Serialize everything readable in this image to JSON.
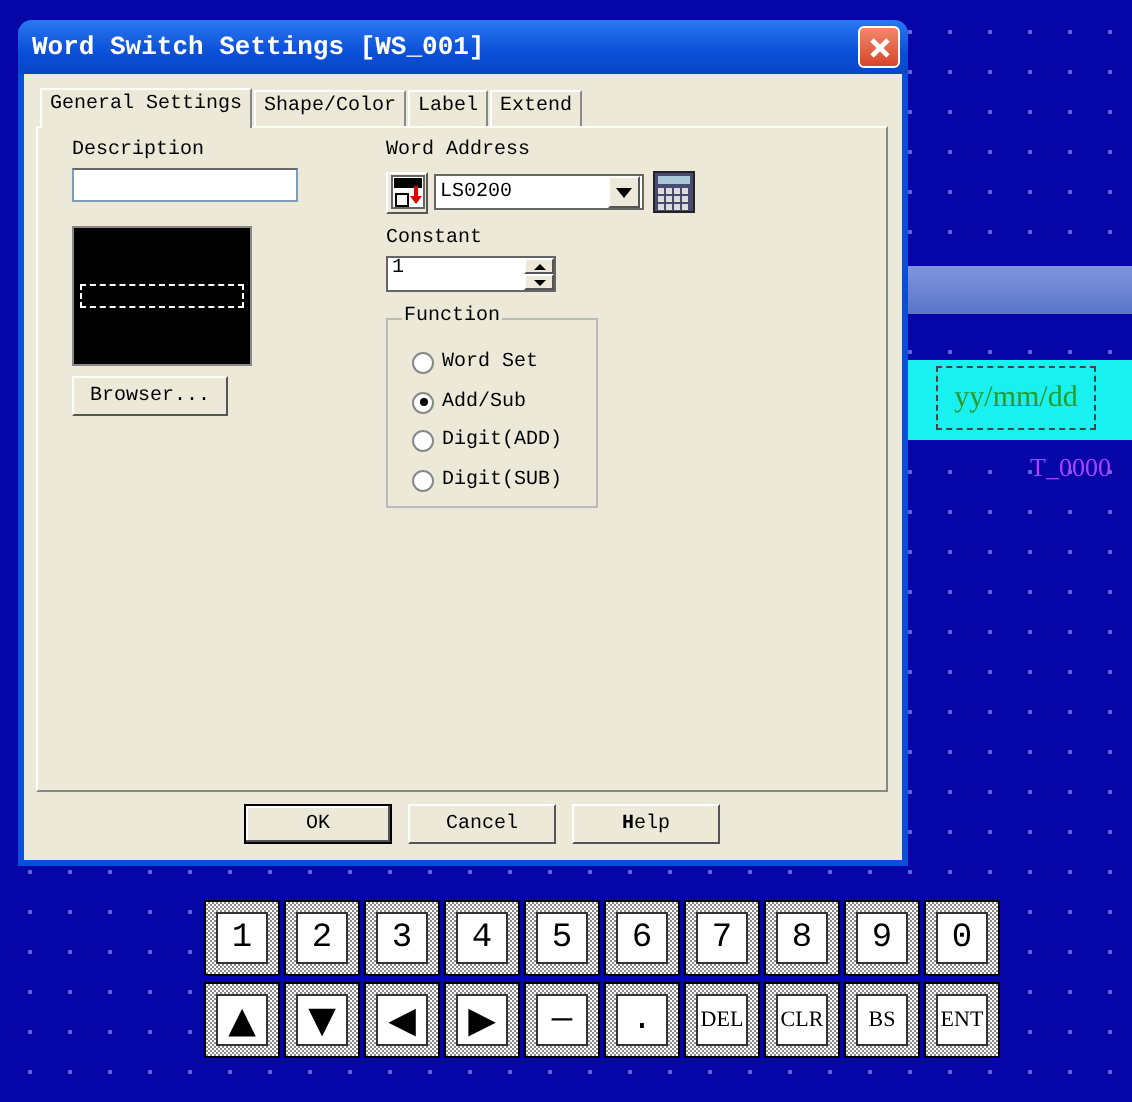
{
  "background": {
    "date_field": "yy/mm/dd",
    "tag": "T_0000"
  },
  "window": {
    "title": "Word Switch Settings [WS_001]"
  },
  "tabs": [
    {
      "label": "General Settings",
      "selected": true
    },
    {
      "label": "Shape/Color",
      "selected": false
    },
    {
      "label": "Label",
      "selected": false
    },
    {
      "label": "Extend",
      "selected": false
    }
  ],
  "description": {
    "label": "Description"
  },
  "browser_button": "Browser...",
  "word_address": {
    "label": "Word Address",
    "value": "LS0200"
  },
  "constant": {
    "label": "Constant",
    "value": "1"
  },
  "function": {
    "label": "Function",
    "options": [
      {
        "label": "Word Set",
        "selected": false
      },
      {
        "label": "Add/Sub",
        "selected": true
      },
      {
        "label": "Digit(ADD)",
        "selected": false
      },
      {
        "label": "Digit(SUB)",
        "selected": false
      }
    ]
  },
  "buttons": [
    {
      "label": "OK",
      "default": true
    },
    {
      "label": "Cancel",
      "default": false
    },
    {
      "label": "**H**elp",
      "default": false
    }
  ],
  "keypad": {
    "rows": [
      [
        {
          "kind": "text",
          "label": "1"
        },
        {
          "kind": "text",
          "label": "2"
        },
        {
          "kind": "text",
          "label": "3"
        },
        {
          "kind": "text",
          "label": "4"
        },
        {
          "kind": "text",
          "label": "5"
        },
        {
          "kind": "text",
          "label": "6"
        },
        {
          "kind": "text",
          "label": "7"
        },
        {
          "kind": "text",
          "label": "8"
        },
        {
          "kind": "text",
          "label": "9"
        },
        {
          "kind": "text",
          "label": "0"
        }
      ],
      [
        {
          "kind": "arrow",
          "label": "▲"
        },
        {
          "kind": "arrow",
          "label": "▼"
        },
        {
          "kind": "arrow",
          "label": "◀"
        },
        {
          "kind": "arrow",
          "label": "▶"
        },
        {
          "kind": "text",
          "label": "—"
        },
        {
          "kind": "text",
          "label": "."
        },
        {
          "kind": "small",
          "label": "DEL"
        },
        {
          "kind": "small",
          "label": "CLR"
        },
        {
          "kind": "small",
          "label": "BS"
        },
        {
          "kind": "small",
          "label": "ENT"
        }
      ]
    ]
  }
}
